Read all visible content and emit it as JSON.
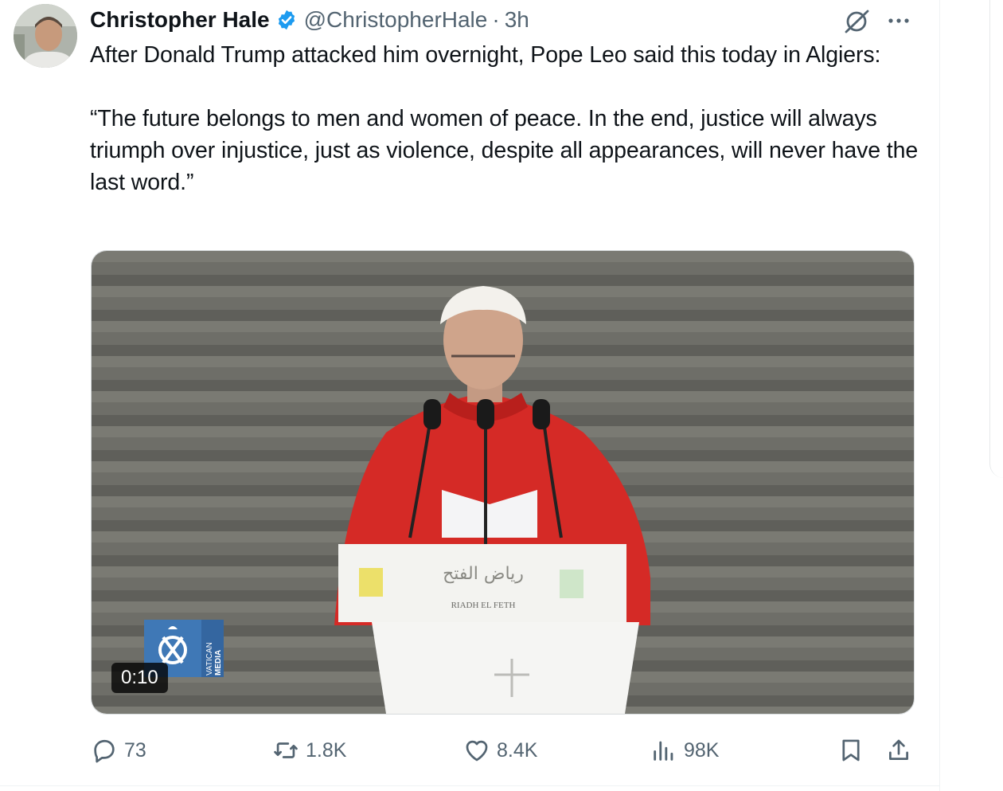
{
  "author": {
    "name": "Christopher Hale",
    "handle": "@ChristopherHale",
    "separator": "·",
    "time": "3h"
  },
  "tweet": {
    "line1": "After Donald Trump attacked him overnight, Pope Leo said this today in Algiers:",
    "line2": "“The future belongs to men and women of peace. In the end, justice will always triumph over injustice, just as violence, despite all appearances, will never have the last word.”"
  },
  "media": {
    "timestamp": "0:10",
    "logo_text_1": "VATICAN",
    "logo_text_2": "MEDIA",
    "podium_text": "RIADH EL FETH",
    "podium_arabic": "رياض الفتح"
  },
  "actions": {
    "replies": "73",
    "reposts": "1.8K",
    "likes": "8.4K",
    "views": "98K"
  },
  "icons": [
    "verified-icon",
    "grok-icon",
    "more-icon",
    "reply-icon",
    "repost-icon",
    "like-icon",
    "views-icon",
    "bookmark-icon",
    "share-icon"
  ],
  "colors": {
    "verified": "#1d9bf0",
    "muted": "#536471",
    "vestment": "#d52a26"
  }
}
